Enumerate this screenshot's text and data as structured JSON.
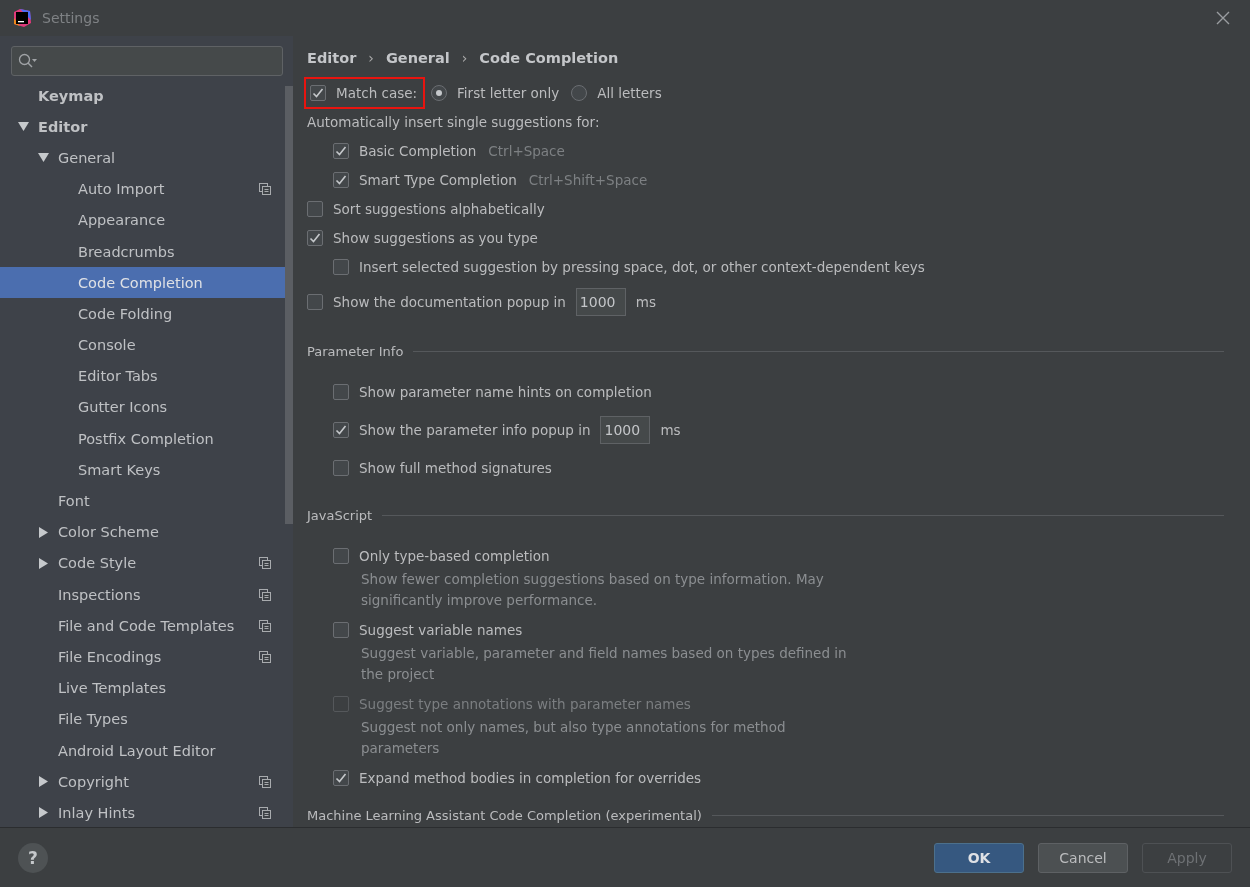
{
  "window": {
    "title": "Settings"
  },
  "sidebar": {
    "items": [
      {
        "label": "Keymap",
        "bold": true,
        "selected": false
      },
      {
        "label": "Editor",
        "bold": true,
        "expanded": true,
        "selected": false,
        "children": [
          {
            "label": "General",
            "expanded": true,
            "selected": false,
            "children": [
              {
                "label": "Auto Import",
                "project_scoped": true,
                "selected": false
              },
              {
                "label": "Appearance",
                "selected": false
              },
              {
                "label": "Breadcrumbs",
                "selected": false
              },
              {
                "label": "Code Completion",
                "selected": true
              },
              {
                "label": "Code Folding",
                "selected": false
              },
              {
                "label": "Console",
                "selected": false
              },
              {
                "label": "Editor Tabs",
                "selected": false
              },
              {
                "label": "Gutter Icons",
                "selected": false
              },
              {
                "label": "Postfix Completion",
                "selected": false
              },
              {
                "label": "Smart Keys",
                "selected": false
              }
            ]
          },
          {
            "label": "Font",
            "selected": false
          },
          {
            "label": "Color Scheme",
            "expanded": false,
            "selected": false
          },
          {
            "label": "Code Style",
            "expanded": false,
            "project_scoped": true,
            "selected": false
          },
          {
            "label": "Inspections",
            "project_scoped": true,
            "selected": false
          },
          {
            "label": "File and Code Templates",
            "project_scoped": true,
            "selected": false
          },
          {
            "label": "File Encodings",
            "project_scoped": true,
            "selected": false
          },
          {
            "label": "Live Templates",
            "selected": false
          },
          {
            "label": "File Types",
            "selected": false
          },
          {
            "label": "Android Layout Editor",
            "selected": false
          },
          {
            "label": "Copyright",
            "expanded": false,
            "project_scoped": true,
            "selected": false
          },
          {
            "label": "Inlay Hints",
            "expanded": false,
            "project_scoped": true,
            "selected": false
          }
        ]
      }
    ]
  },
  "breadcrumbs": [
    "Editor",
    "General",
    "Code Completion"
  ],
  "breadcrumb_separator": "›",
  "options": [
    {
      "kind": "match",
      "label": "Match case:",
      "checked": true,
      "highlighted": true,
      "radios": [
        {
          "label": "First letter only",
          "selected": true
        },
        {
          "label": "All letters",
          "selected": false
        }
      ]
    },
    {
      "kind": "text",
      "label": "Automatically insert single suggestions for:",
      "children": [
        {
          "kind": "checkbox",
          "label": "Basic Completion",
          "shortcut": "Ctrl+Space",
          "checked": true
        },
        {
          "kind": "checkbox",
          "label": "Smart Type Completion",
          "shortcut": "Ctrl+Shift+Space",
          "checked": true
        }
      ]
    },
    {
      "kind": "checkbox",
      "label": "Sort suggestions alphabetically",
      "checked": false
    },
    {
      "kind": "checkbox",
      "label": "Show suggestions as you type",
      "checked": true,
      "children": [
        {
          "kind": "checkbox",
          "label": "Insert selected suggestion by pressing space, dot, or other context-dependent keys",
          "checked": false
        }
      ]
    },
    {
      "kind": "number",
      "label": "Show the documentation popup in",
      "checked": false,
      "value": "1000",
      "unit": "ms"
    },
    {
      "kind": "section",
      "label": "Parameter Info",
      "children": [
        {
          "kind": "checkbox",
          "label": "Show parameter name hints on completion",
          "checked": false
        },
        {
          "kind": "number",
          "label": "Show the parameter info popup in",
          "checked": true,
          "value": "1000",
          "unit": "ms"
        },
        {
          "kind": "checkbox",
          "label": "Show full method signatures",
          "checked": false
        }
      ]
    },
    {
      "kind": "section",
      "label": "JavaScript",
      "children": [
        {
          "kind": "checkbox",
          "label": "Only type-based completion",
          "checked": false,
          "description": "Show fewer completion suggestions based on type information. May significantly improve performance."
        },
        {
          "kind": "checkbox",
          "label": "Suggest variable names",
          "checked": false,
          "description": "Suggest variable, parameter and field names based on types defined in the project"
        },
        {
          "kind": "checkbox",
          "label": "Suggest type annotations with parameter names",
          "checked": false,
          "disabled": true,
          "description": "Suggest not only names, but also type annotations for method parameters"
        },
        {
          "kind": "checkbox",
          "label": "Expand method bodies in completion for overrides",
          "checked": true
        }
      ]
    },
    {
      "kind": "section",
      "label": "Machine Learning Assistant Code Completion (experimental)"
    }
  ],
  "help": "?",
  "buttons": [
    {
      "label": "OK",
      "kind": "primary"
    },
    {
      "label": "Cancel",
      "kind": "normal"
    },
    {
      "label": "Apply",
      "kind": "disabled"
    }
  ]
}
